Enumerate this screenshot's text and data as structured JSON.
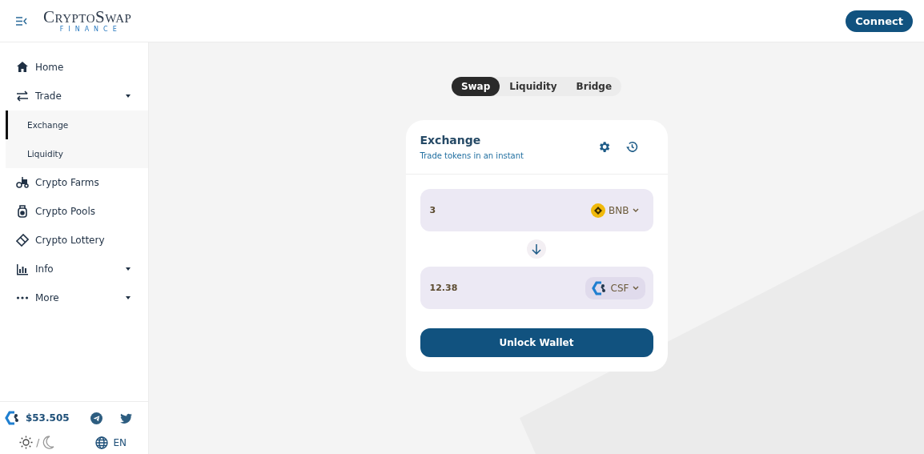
{
  "header": {
    "logo": {
      "name": "CryptoSwap",
      "tagline": "FINANCE"
    },
    "connect_button": "Connect"
  },
  "sidebar": {
    "items": [
      {
        "label": "Home",
        "kind": "link"
      },
      {
        "label": "Trade",
        "kind": "group",
        "expanded": true,
        "children": [
          {
            "label": "Exchange",
            "selected": true
          },
          {
            "label": "Liquidity",
            "selected": false
          }
        ]
      },
      {
        "label": "Crypto Farms",
        "kind": "link"
      },
      {
        "label": "Crypto Pools",
        "kind": "link"
      },
      {
        "label": "Crypto Lottery",
        "kind": "link"
      },
      {
        "label": "Info",
        "kind": "group"
      },
      {
        "label": "More",
        "kind": "group"
      }
    ],
    "price": "$53.505",
    "theme_separator": "/",
    "language": "EN"
  },
  "tabs": [
    {
      "label": "Swap",
      "selected": true
    },
    {
      "label": "Liquidity",
      "selected": false
    },
    {
      "label": "Bridge",
      "selected": false
    }
  ],
  "card": {
    "title": "Exchange",
    "subtitle": "Trade tokens in an instant",
    "inputs": [
      {
        "value": "3",
        "token": "BNB",
        "kind": "bnb"
      },
      {
        "value": "12.38",
        "token": "CSF",
        "kind": "csf"
      }
    ],
    "button": "Unlock Wallet"
  }
}
